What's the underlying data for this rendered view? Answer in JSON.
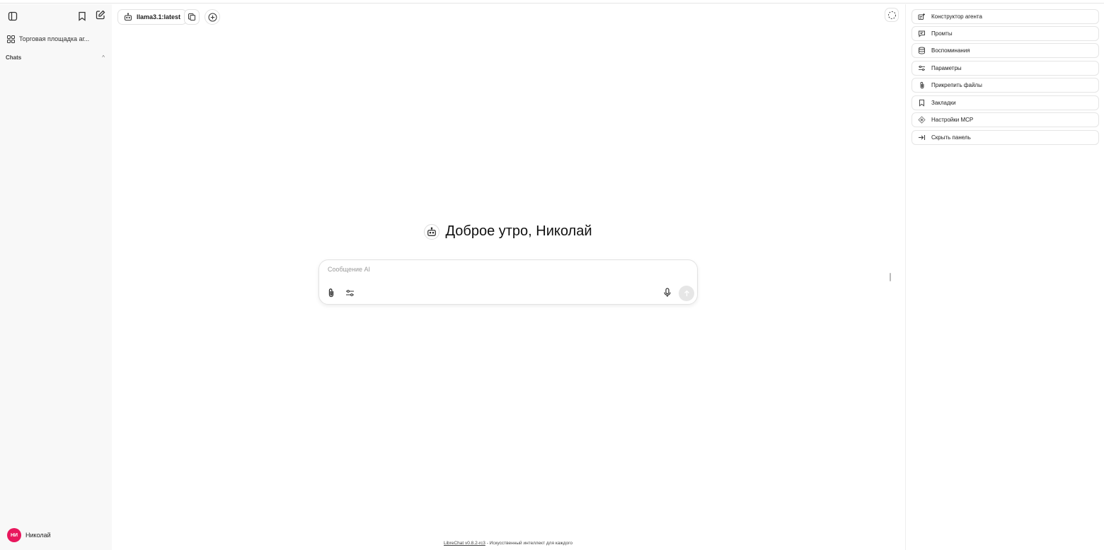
{
  "sidebar": {
    "marketplace_label": "Торговая площадка аг...",
    "chats_label": "Chats",
    "chats_chevron": "^",
    "user": {
      "initials": "НИ",
      "name": "Николай",
      "avatar_color": "#e8175d"
    }
  },
  "topbar": {
    "model_label": "llama3.1:latest"
  },
  "main": {
    "greeting": "Доброе утро, Николай",
    "input_placeholder": "Сообщение AI"
  },
  "footer": {
    "link_text": "LibreChat v0.8.2-rc3",
    "tagline": " - Искусственный интеллект для каждого"
  },
  "right_panel": {
    "items": [
      {
        "label": "Конструктор агента",
        "icon": "agent-builder-icon"
      },
      {
        "label": "Промты",
        "icon": "prompts-icon"
      },
      {
        "label": "Воспоминания",
        "icon": "memory-icon"
      },
      {
        "label": "Параметры",
        "icon": "sliders-icon"
      },
      {
        "label": "Прикрепить файлы",
        "icon": "paperclip-icon"
      },
      {
        "label": "Закладки",
        "icon": "bookmark-icon"
      },
      {
        "label": "Настройки MCP",
        "icon": "mcp-icon"
      },
      {
        "label": "Скрыть панель",
        "icon": "collapse-panel-icon"
      }
    ]
  },
  "colors": {
    "accent": "#e8175d",
    "sidebar_bg": "#f8f8f8",
    "send_button_disabled": "#e6e6e6"
  }
}
